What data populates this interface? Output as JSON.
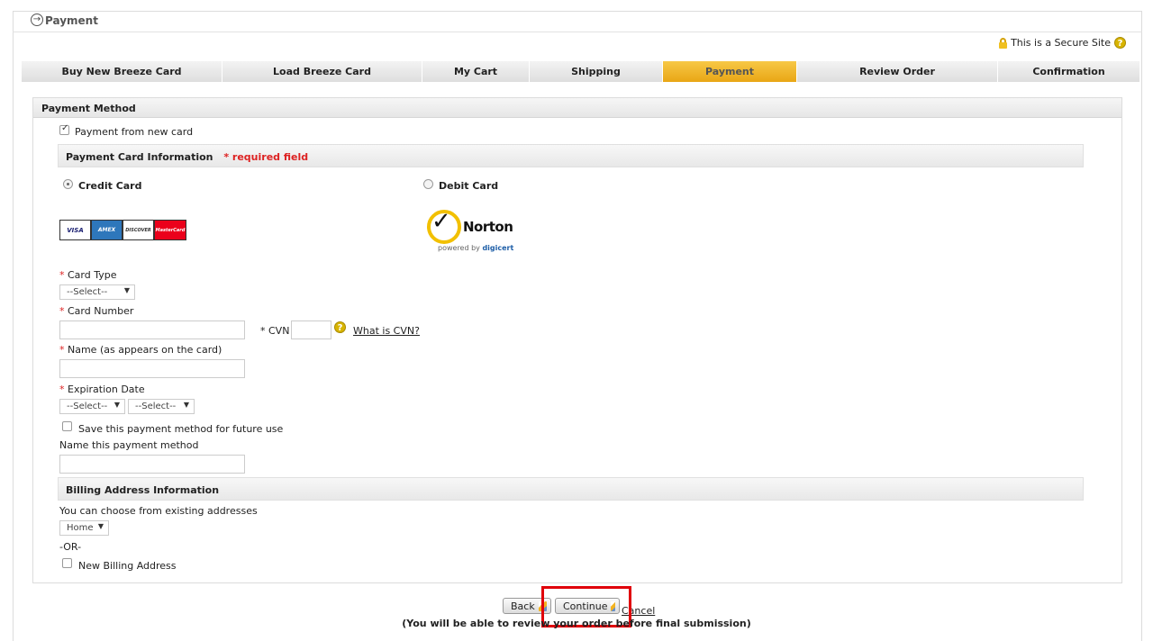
{
  "page": {
    "title": "Payment",
    "secure_text": "This is a Secure Site"
  },
  "tabs": [
    {
      "label": "Buy New Breeze Card",
      "active": false
    },
    {
      "label": "Load Breeze Card",
      "active": false
    },
    {
      "label": "My Cart",
      "active": false
    },
    {
      "label": "Shipping",
      "active": false
    },
    {
      "label": "Payment",
      "active": true
    },
    {
      "label": "Review Order",
      "active": false
    },
    {
      "label": "Confirmation",
      "active": false
    }
  ],
  "payment_method": {
    "heading": "Payment Method",
    "new_card_label": "Payment from new card",
    "new_card_checked": true
  },
  "card_info": {
    "heading": "Payment Card Information",
    "required_note": "* required field",
    "credit_label": "Credit Card",
    "debit_label": "Debit Card",
    "selected": "Credit Card",
    "card_logos": [
      "VISA",
      "AMEX",
      "DISCOVER",
      "MasterCard"
    ],
    "norton": {
      "word": "Norton",
      "powered_by": "powered by",
      "brand": "digicert"
    }
  },
  "form": {
    "card_type_label": "Card Type",
    "card_type_value": "--Select--",
    "card_number_label": "Card Number",
    "card_number_value": "",
    "cvn_label": "* CVN",
    "cvn_value": "",
    "cvn_help_link": "What is CVN?",
    "name_label": "Name (as appears on the card)",
    "name_value": "",
    "expiration_label": "Expiration Date",
    "exp_month_value": "--Select--",
    "exp_year_value": "--Select--",
    "save_label": "Save this payment method for future use",
    "save_checked": false,
    "name_method_label": "Name this payment method",
    "name_method_value": "",
    "required_star": "*"
  },
  "billing": {
    "heading": "Billing Address Information",
    "choose_label": "You can choose from existing addresses",
    "address_value": "Home",
    "or_text": "-OR-",
    "new_address_label": "New Billing Address",
    "new_address_checked": false
  },
  "actions": {
    "back_label": "Back",
    "continue_label": "Continue",
    "cancel_label": "Cancel",
    "note": "(You will be able to review your order before final submission)"
  },
  "colors": {
    "active_tab": "#e9a615",
    "highlight_box": "#e0000a",
    "required_star": "#d22222"
  }
}
